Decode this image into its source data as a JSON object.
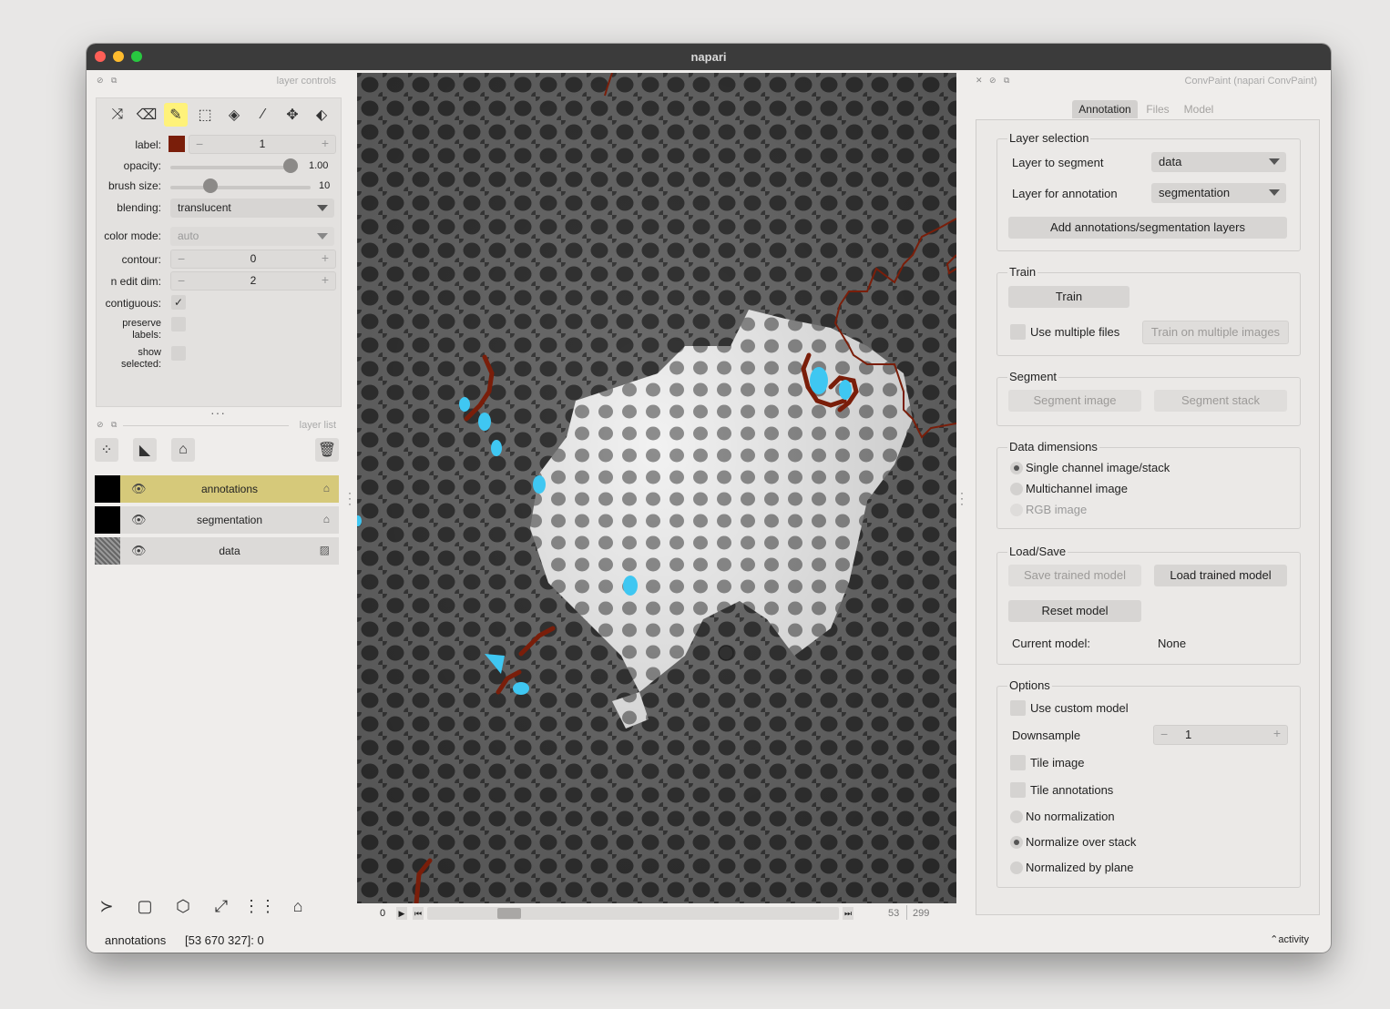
{
  "window": {
    "title": "napari"
  },
  "layer_controls": {
    "header": "layer controls",
    "label_label": "label:",
    "label_value": "1",
    "label_color": "#7a1e0a",
    "opacity_label": "opacity:",
    "opacity_value": "1.00",
    "opacity_fraction": 1.0,
    "brush_label": "brush size:",
    "brush_value": "10",
    "brush_fraction": 0.26,
    "blending_label": "blending:",
    "blending_value": "translucent",
    "color_mode_label": "color mode:",
    "color_mode_value": "auto",
    "contour_label": "contour:",
    "contour_value": "0",
    "n_edit_dim_label": "n edit dim:",
    "n_edit_dim_value": "2",
    "contiguous_label": "contiguous:",
    "preserve_label": "preserve\nlabels:",
    "show_selected_label": "show\nselected:"
  },
  "layer_list": {
    "header": "layer list",
    "layers": [
      {
        "name": "annotations",
        "selected": true
      },
      {
        "name": "segmentation",
        "selected": false
      },
      {
        "name": "data",
        "selected": false
      }
    ]
  },
  "dims": {
    "axis": "0",
    "current": "53",
    "total": "299",
    "position_fraction": 0.18
  },
  "status": {
    "layer": "annotations",
    "coords": "[53 670 327]: 0",
    "activity": "activity"
  },
  "convpaint": {
    "header": "ConvPaint (napari ConvPaint)",
    "tabs": [
      "Annotation",
      "Files",
      "Model"
    ],
    "layer_selection": {
      "title": "Layer selection",
      "segment_label": "Layer to segment",
      "segment_value": "data",
      "annotation_label": "Layer for annotation",
      "annotation_value": "segmentation",
      "add_button": "Add annotations/segmentation layers"
    },
    "train": {
      "title": "Train",
      "train_button": "Train",
      "multi_files_label": "Use multiple files",
      "train_multi_button": "Train on multiple images"
    },
    "segment": {
      "title": "Segment",
      "image_button": "Segment image",
      "stack_button": "Segment stack"
    },
    "data_dimensions": {
      "title": "Data dimensions",
      "options": [
        "Single channel image/stack",
        "Multichannel image",
        "RGB image"
      ]
    },
    "load_save": {
      "title": "Load/Save",
      "save_button": "Save trained model",
      "load_button": "Load trained model",
      "reset_button": "Reset model",
      "current_label": "Current model:",
      "current_value": "None"
    },
    "options": {
      "title": "Options",
      "custom_model_label": "Use custom model",
      "downsample_label": "Downsample",
      "downsample_value": "1",
      "tile_image_label": "Tile image",
      "tile_annotations_label": "Tile annotations",
      "norm_options": [
        "No normalization",
        "Normalize over stack",
        "Normalized by plane"
      ]
    }
  },
  "colors": {
    "annotation_brown": "#7a1e0a",
    "annotation_cyan": "#3fc7f2",
    "selected_layer": "#d6c97a",
    "active_tool": "#fff27a"
  }
}
